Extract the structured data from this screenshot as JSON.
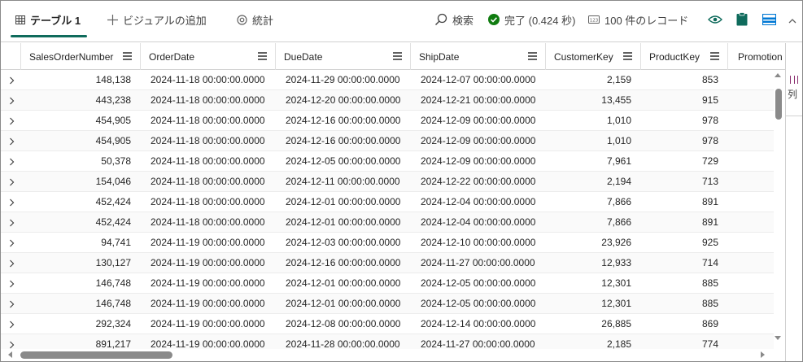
{
  "toolbar": {
    "tabs": [
      {
        "label": "テーブル 1",
        "icon": "table-icon"
      },
      {
        "label": "ビジュアルの追加",
        "icon": "plus-icon"
      },
      {
        "label": "統計",
        "icon": "statistics-icon"
      }
    ],
    "search_label": "検索",
    "status_label": "完了 (0.424 秒)",
    "record_count_label": "100 件のレコード",
    "accent_color": "#0f6b5c",
    "success_color": "#107c10",
    "buttons": [
      "eye-icon",
      "clipboard-icon",
      "layout-icon",
      "collapse-chevron-icon"
    ]
  },
  "grid": {
    "columns": [
      "SalesOrderNumber",
      "OrderDate",
      "DueDate",
      "ShipDate",
      "CustomerKey",
      "ProductKey",
      "Promotion"
    ],
    "rows": [
      [
        "148,138",
        "2024-11-18 00:00:00.0000",
        "2024-11-29 00:00:00.0000",
        "2024-12-07 00:00:00.0000",
        "2,159",
        "853"
      ],
      [
        "443,238",
        "2024-11-18 00:00:00.0000",
        "2024-12-20 00:00:00.0000",
        "2024-12-21 00:00:00.0000",
        "13,455",
        "915"
      ],
      [
        "454,905",
        "2024-11-18 00:00:00.0000",
        "2024-12-16 00:00:00.0000",
        "2024-12-09 00:00:00.0000",
        "1,010",
        "978"
      ],
      [
        "454,905",
        "2024-11-18 00:00:00.0000",
        "2024-12-16 00:00:00.0000",
        "2024-12-09 00:00:00.0000",
        "1,010",
        "978"
      ],
      [
        "50,378",
        "2024-11-18 00:00:00.0000",
        "2024-12-05 00:00:00.0000",
        "2024-12-09 00:00:00.0000",
        "7,961",
        "729"
      ],
      [
        "154,046",
        "2024-11-18 00:00:00.0000",
        "2024-12-11 00:00:00.0000",
        "2024-12-22 00:00:00.0000",
        "2,194",
        "713"
      ],
      [
        "452,424",
        "2024-11-18 00:00:00.0000",
        "2024-12-01 00:00:00.0000",
        "2024-12-04 00:00:00.0000",
        "7,866",
        "891"
      ],
      [
        "452,424",
        "2024-11-18 00:00:00.0000",
        "2024-12-01 00:00:00.0000",
        "2024-12-04 00:00:00.0000",
        "7,866",
        "891"
      ],
      [
        "94,741",
        "2024-11-19 00:00:00.0000",
        "2024-12-03 00:00:00.0000",
        "2024-12-10 00:00:00.0000",
        "23,926",
        "925"
      ],
      [
        "130,127",
        "2024-11-19 00:00:00.0000",
        "2024-12-16 00:00:00.0000",
        "2024-11-27 00:00:00.0000",
        "12,933",
        "714"
      ],
      [
        "146,748",
        "2024-11-19 00:00:00.0000",
        "2024-12-01 00:00:00.0000",
        "2024-12-05 00:00:00.0000",
        "12,301",
        "885"
      ],
      [
        "146,748",
        "2024-11-19 00:00:00.0000",
        "2024-12-01 00:00:00.0000",
        "2024-12-05 00:00:00.0000",
        "12,301",
        "885"
      ],
      [
        "292,324",
        "2024-11-19 00:00:00.0000",
        "2024-12-08 00:00:00.0000",
        "2024-12-14 00:00:00.0000",
        "26,885",
        "869"
      ],
      [
        "891,217",
        "2024-11-19 00:00:00.0000",
        "2024-11-28 00:00:00.0000",
        "2024-11-27 00:00:00.0000",
        "2,185",
        "774"
      ]
    ]
  },
  "side_pane": {
    "label": "列",
    "icon": "columns-icon"
  }
}
